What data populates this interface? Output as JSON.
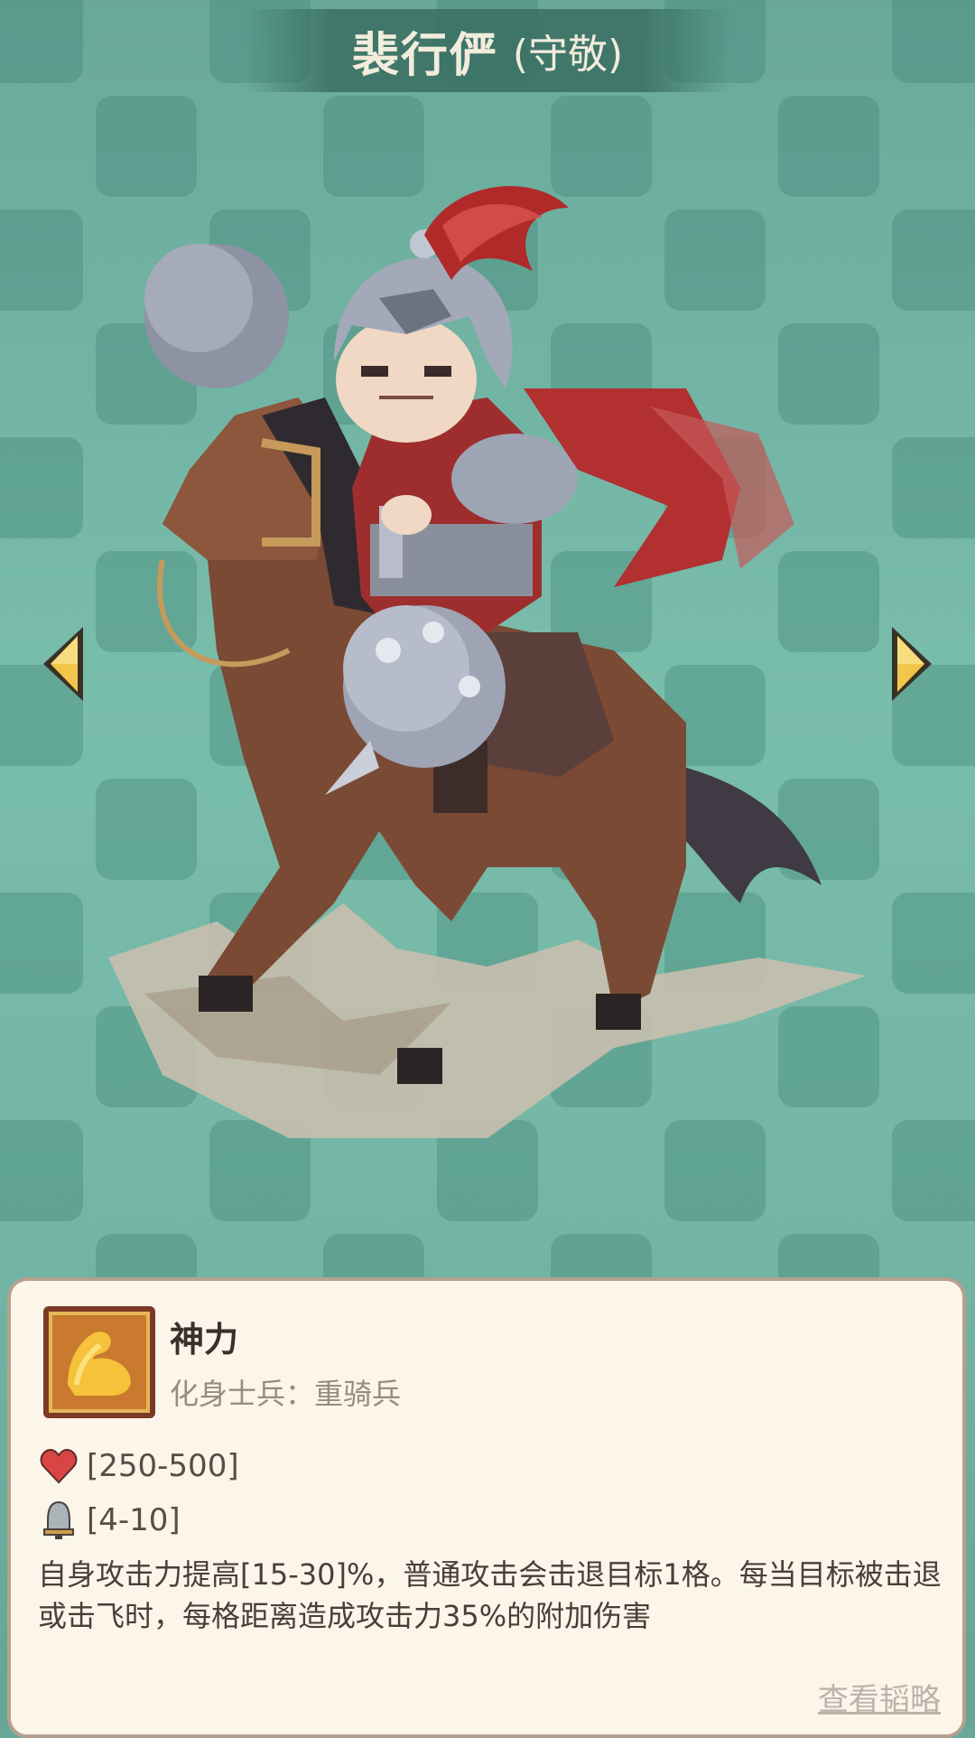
{
  "header": {
    "name": "裴行俨",
    "courtesy": "(守敬)"
  },
  "nav": {
    "prev_icon": "chevron-left-icon",
    "next_icon": "chevron-right-icon"
  },
  "hero": {
    "portrait_icon": "mounted-warrior-with-hammer"
  },
  "skill": {
    "icon": "flexed-arm-icon",
    "name": "神力",
    "subtitle": "化身士兵：重骑兵",
    "hp_icon": "heart-icon",
    "hp_range": "[250-500]",
    "range_icon": "bell-icon",
    "attack_range": "[4-10]",
    "description": "自身攻击力提高[15-30]%，普通攻击会击退目标1格。每当目标被击退或击飞时，每格距离造成攻击力35%的附加伤害",
    "guide_link": "查看韬略"
  },
  "colors": {
    "background": "#74b6a5",
    "panel": "#fbf5ea",
    "arrow": "#f2c64a",
    "title_text": "#f2ecdc"
  }
}
